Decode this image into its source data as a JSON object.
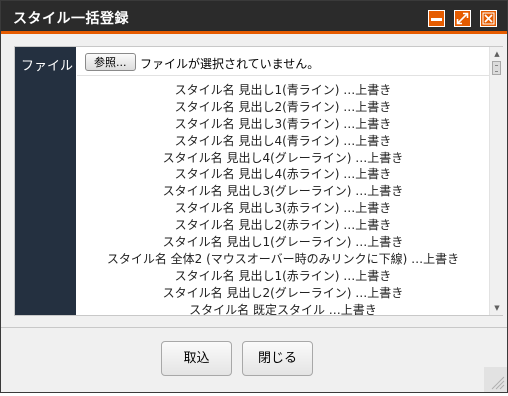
{
  "window": {
    "title": "スタイル一括登録",
    "accent_color": "#e65c00",
    "titlebar_color": "#2b2b2b",
    "controls": [
      {
        "name": "minimize",
        "icon": "minimize-icon"
      },
      {
        "name": "maximize",
        "icon": "expand-icon"
      },
      {
        "name": "close",
        "icon": "close-icon"
      }
    ]
  },
  "form": {
    "file_label": "ファイル",
    "browse_label": "参照...",
    "file_status": "ファイルが選択されていません。"
  },
  "results": [
    "スタイル名 見出し1(青ライン) …上書き",
    "スタイル名 見出し2(青ライン) …上書き",
    "スタイル名 見出し3(青ライン) …上書き",
    "スタイル名 見出し4(青ライン) …上書き",
    "スタイル名 見出し4(グレーライン) …上書き",
    "スタイル名 見出し4(赤ライン) …上書き",
    "スタイル名 見出し3(グレーライン) …上書き",
    "スタイル名 見出し3(赤ライン) …上書き",
    "スタイル名 見出し2(赤ライン) …上書き",
    "スタイル名 見出し1(グレーライン) …上書き",
    "スタイル名 全体2 (マウスオーバー時のみリンクに下線) …上書き",
    "スタイル名 見出し1(赤ライン) …上書き",
    "スタイル名 見出し2(グレーライン) …上書き",
    "スタイル名 既定スタイル …上書き"
  ],
  "footer": {
    "import_label": "取込",
    "close_label": "閉じる"
  }
}
